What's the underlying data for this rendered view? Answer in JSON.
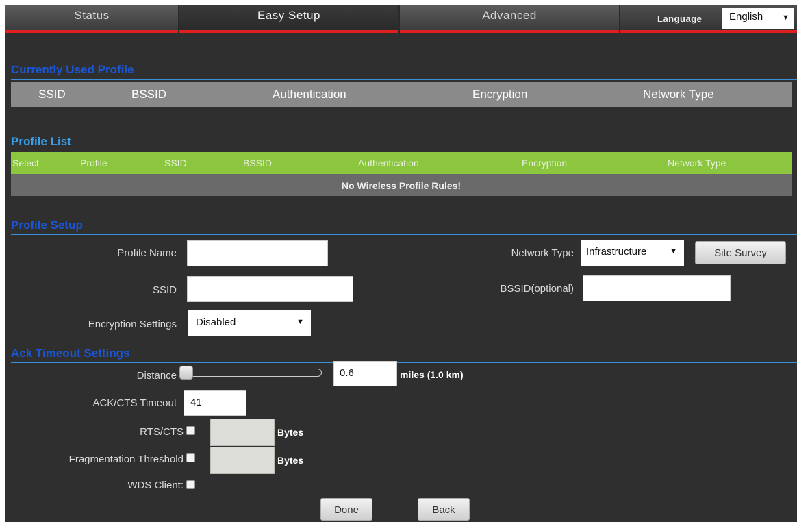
{
  "nav": {
    "tabs": [
      "Status",
      "Easy Setup",
      "Advanced"
    ],
    "active_tab": "Easy Setup",
    "language_label": "Language",
    "language_value": "English"
  },
  "current_profile": {
    "title": "Currently Used Profile",
    "columns": [
      "SSID",
      "BSSID",
      "Authentication",
      "Encryption",
      "Network Type"
    ]
  },
  "profile_list": {
    "title": "Profile List",
    "columns": [
      "Select",
      "Profile",
      "SSID",
      "BSSID",
      "Authentication",
      "Encryption",
      "Network Type"
    ],
    "empty_message": "No Wireless Profile Rules!"
  },
  "profile_setup": {
    "title": "Profile Setup",
    "profile_name_label": "Profile Name",
    "profile_name_value": "",
    "ssid_label": "SSID",
    "ssid_value": "",
    "encryption_label": "Encryption Settings",
    "encryption_value": "Disabled",
    "network_type_label": "Network Type",
    "network_type_value": "Infrastructure",
    "site_survey_label": "Site Survey",
    "bssid_label": "BSSID(optional)",
    "bssid_value": ""
  },
  "ack_timeout": {
    "title": "Ack Timeout Settings",
    "distance_label": "Distance",
    "distance_value": "0.6",
    "distance_slider_fraction": 0.0,
    "distance_unit": "miles (1.0 km)",
    "ack_cts_label": "ACK/CTS Timeout",
    "ack_cts_value": "41",
    "rts_cts_label": "RTS/CTS",
    "rts_cts_unit": "Bytes",
    "frag_label": "Fragmentation Threshold",
    "frag_unit": "Bytes",
    "wds_label": "WDS Client:"
  },
  "actions": {
    "done_label": "Done",
    "back_label": "Back"
  },
  "colors": {
    "panel_bg": "#2f2f2f",
    "nav_accent": "#e02020",
    "section_title": "#1a56d6",
    "profile_list_title": "#3aa0e8",
    "list_header": "#8cc63f",
    "current_header": "#8a8a8a"
  }
}
